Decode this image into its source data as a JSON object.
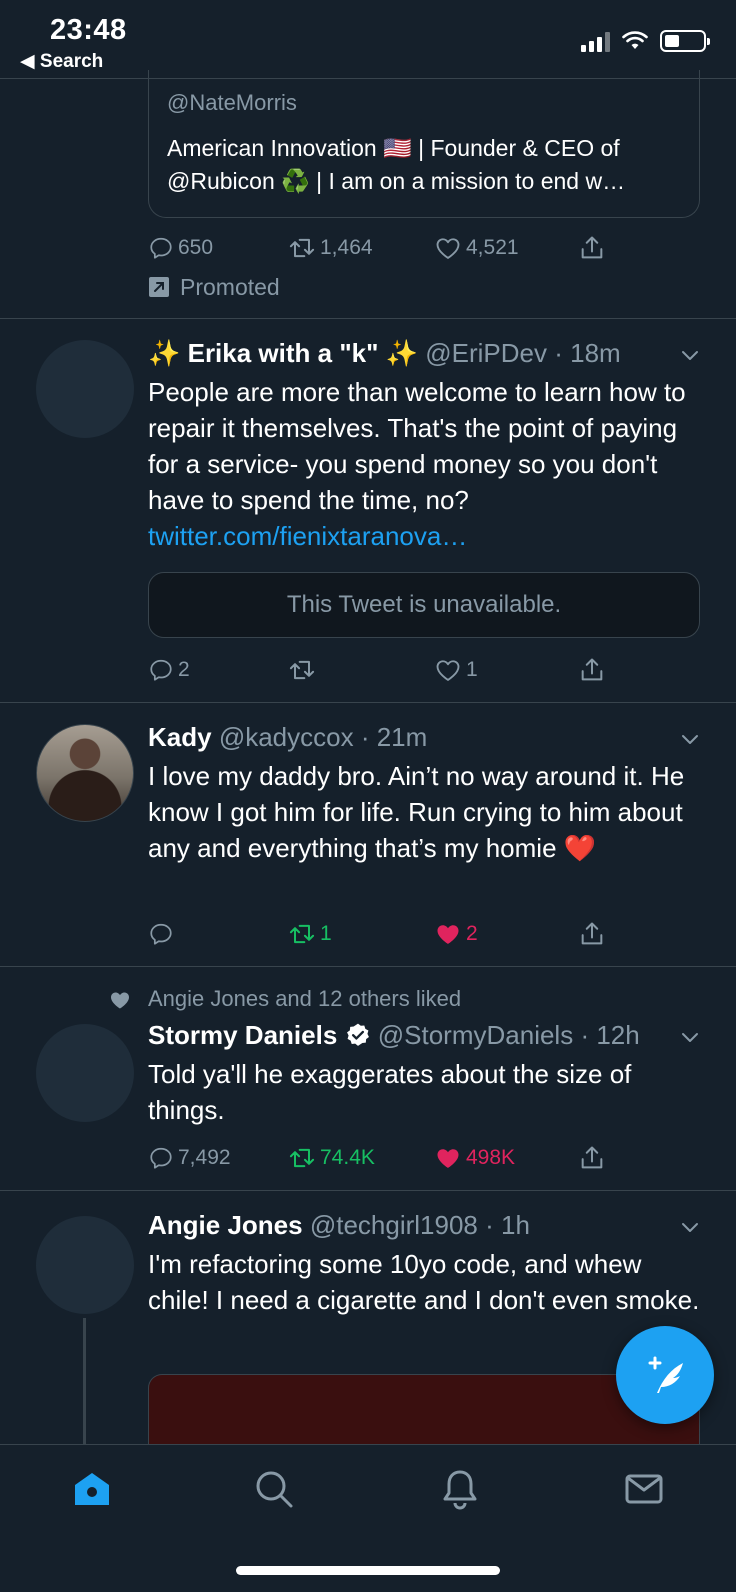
{
  "status": {
    "time": "23:48",
    "back_label": "◀ Search"
  },
  "promoted_card": {
    "handle": "@NateMorris",
    "bio": "American Innovation 🇺🇸 | Founder & CEO of @Rubicon ♻️ | I am on a mission to end w…",
    "replies": "650",
    "retweets": "1,464",
    "likes": "4,521",
    "promoted_label": "Promoted"
  },
  "tweets": [
    {
      "name": "✨ Erika with a \"k\" ✨",
      "handle": "@EriPDev",
      "time": "18m",
      "text": "People are more than welcome to learn how to repair it themselves. That's the point of paying for a service- you spend money so you don't have to spend the time, no? ",
      "link": "twitter.com/fienixtaranova…",
      "quoted": "This Tweet is unavailable.",
      "replies": "2",
      "retweets": "",
      "likes": "1"
    },
    {
      "name": "Kady",
      "handle": "@kadyccox",
      "time": "21m",
      "text": "I love my daddy bro. Ain’t no way around it. He know I got him for life. Run crying to him about any and everything that’s my homie ❤️",
      "replies": "",
      "retweets": "1",
      "likes": "2"
    },
    {
      "context": "Angie Jones and 12 others liked",
      "name": "Stormy Daniels",
      "handle": "@StormyDaniels",
      "time": "12h",
      "text": "Told ya'll he exaggerates about the size of things.",
      "replies": "7,492",
      "retweets": "74.4K",
      "likes": "498K"
    },
    {
      "name": "Angie Jones",
      "handle": "@techgirl1908",
      "time": "1h",
      "text": "I'm refactoring some 10yo code, and whew chile! I need a cigarette and I don't even smoke."
    }
  ],
  "separator": " · ",
  "colors": {
    "background": "#15202b",
    "accent": "#1da1f2",
    "retweet_active": "#17bf63",
    "like_active": "#e0245e",
    "secondary_text": "#8899a6",
    "border": "#38444d"
  },
  "icons": [
    "reply-icon",
    "retweet-icon",
    "like-icon",
    "share-icon",
    "promoted-icon",
    "verified-icon",
    "chevron-down-icon",
    "compose-icon",
    "home-icon",
    "search-icon",
    "notifications-icon",
    "messages-icon"
  ]
}
